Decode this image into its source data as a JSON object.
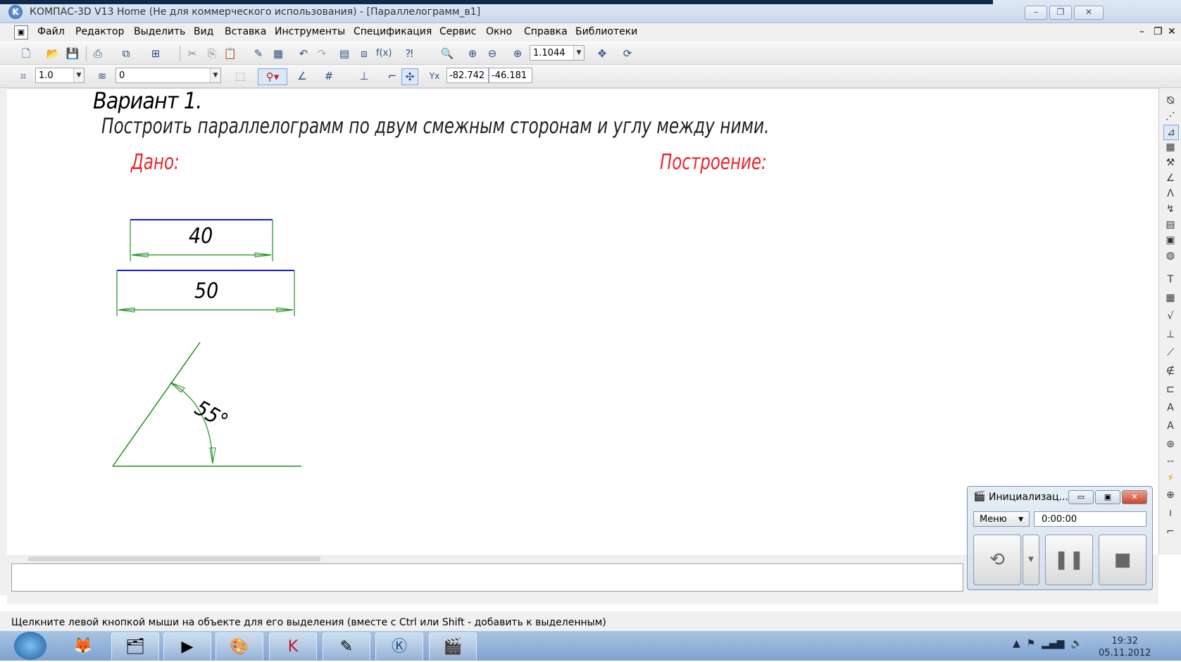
{
  "window": {
    "title": "КОМПАС-3D V13 Home (Не для коммерческого использования) - [Параллелограмм_в1]",
    "app_icon_letter": "K",
    "controls": {
      "minimize": "–",
      "maximize": "❐",
      "close": "✕"
    }
  },
  "menu": {
    "items": [
      "Файл",
      "Редактор",
      "Выделить",
      "Вид",
      "Вставка",
      "Инструменты",
      "Спецификация",
      "Сервис",
      "Окно",
      "Справка",
      "Библиотеки"
    ],
    "doc_controls": {
      "minimize": "–",
      "restore": "❐",
      "close": "✕"
    }
  },
  "toolbar1": {
    "zoom_value": "1.1044",
    "icons": [
      "new-icon",
      "open-icon",
      "save-icon",
      "print-icon",
      "preview-icon",
      "properties-icon",
      "cut-icon",
      "copy-icon",
      "paste-icon",
      "format-brush-icon",
      "table-icon",
      "undo-icon",
      "redo-icon",
      "manager-icon",
      "variables-icon",
      "fx-icon",
      "help-icon",
      "zoom-window-icon",
      "zoom-in-icon",
      "zoom-out-icon",
      "zoom-scale-icon",
      "pan-icon",
      "refresh-icon"
    ]
  },
  "toolbar2": {
    "step_value": "1.0",
    "layer_value": "0",
    "coord_x": "-82.742",
    "coord_y": "-46.181"
  },
  "drawing": {
    "heading": "Вариант 1.",
    "task": "Построить параллелограмм по двум смежным сторонам и углу между ними.",
    "given_label": "Дано:",
    "construction_label": "Построение:",
    "dim_a": "40",
    "dim_b": "50",
    "angle": "55°",
    "colors": {
      "blue": "#1a1ad0",
      "green": "#1f8f1f",
      "red": "#e8262b"
    }
  },
  "status": {
    "hint": "Щелкните левой кнопкой мыши на объекте для его выделения (вместе с Ctrl или Shift - добавить к выделенным)"
  },
  "recorder": {
    "title": "Инициализац...",
    "menu_label": "Меню",
    "time": "0:00:00"
  },
  "taskbar": {
    "time": "19:32",
    "date": "05.11.2012",
    "apps": [
      "firefox-icon",
      "explorer-icon",
      "media-player-icon",
      "paint-icon",
      "kaspersky-icon",
      "notes-icon",
      "kompas-icon",
      "recorder-icon"
    ]
  }
}
